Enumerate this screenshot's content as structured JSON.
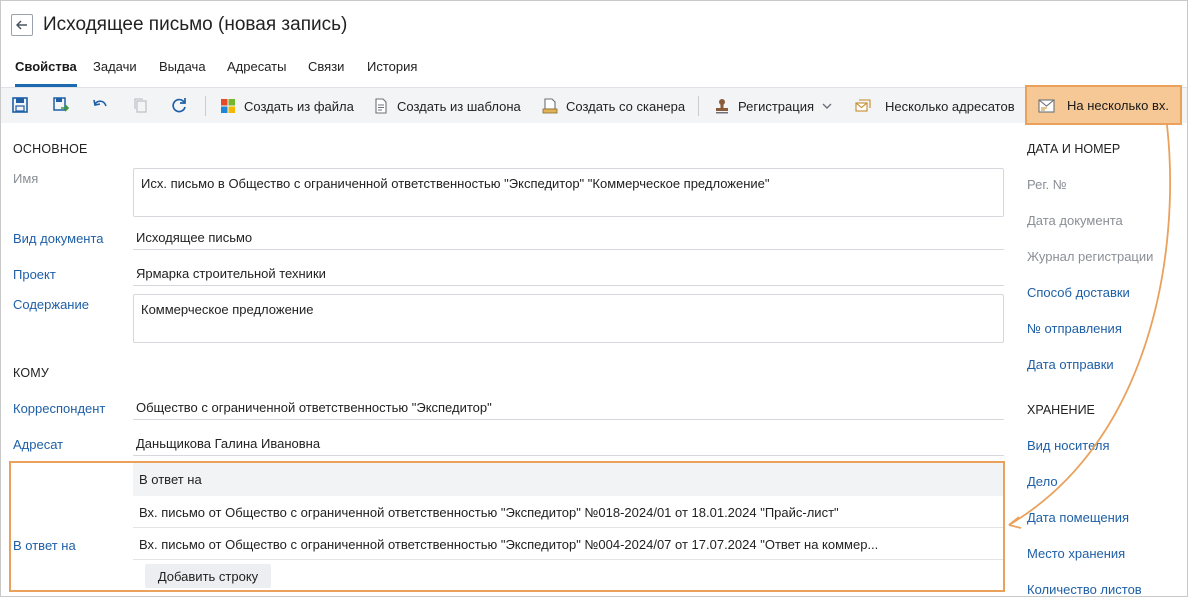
{
  "header": {
    "title": "Исходящее письмо (новая запись)",
    "tabs": [
      {
        "label": "Свойства",
        "active": true
      },
      {
        "label": "Задачи"
      },
      {
        "label": "Выдача"
      },
      {
        "label": "Адресаты"
      },
      {
        "label": "Связи"
      },
      {
        "label": "История"
      }
    ]
  },
  "toolbar": {
    "icons": [
      "save-icon",
      "save-and-close-icon",
      "undo-icon",
      "copy-icon",
      "refresh-icon"
    ],
    "create_from_file": "Создать из файла",
    "create_from_template": "Создать из шаблона",
    "create_from_scanner": "Создать со сканера",
    "registration": "Регистрация",
    "several_addressees": "Несколько адресатов",
    "several_incoming": "На несколько вх."
  },
  "main": {
    "section_basic": "ОСНОВНОЕ",
    "name_label": "Имя",
    "name_value": "Исх. письмо в Общество с ограниченной ответственностью \"Экспедитор\" \"Коммерческое предложение\"",
    "doc_type_label": "Вид документа",
    "doc_type_value": "Исходящее письмо",
    "project_label": "Проект",
    "project_value": "Ярмарка строительной техники",
    "content_label": "Содержание",
    "content_value": "Коммерческое предложение",
    "section_to": "КОМУ",
    "correspondent_label": "Корреспондент",
    "correspondent_value": "Общество с ограниченной ответственностью \"Экспедитор\"",
    "addressee_label": "Адресат",
    "addressee_value": "Даньщикова Галина Ивановна",
    "in_reply_label": "В ответ на",
    "in_reply_header": "В ответ на",
    "in_reply_rows": [
      "Вх. письмо от Общество с ограниченной ответственностью \"Экспедитор\" №018-2024/01 от 18.01.2024 \"Прайс-лист\"",
      "Вх. письмо от Общество с ограниченной ответственностью \"Экспедитор\" №004-2024/07 от 17.07.2024 \"Ответ на коммер..."
    ],
    "add_row": "Добавить строку"
  },
  "right_panel": {
    "section_date": "ДАТА И НОМЕР",
    "reg_no": "Рег. №",
    "doc_date": "Дата документа",
    "reg_journal": "Журнал регистрации",
    "delivery_method": "Способ доставки",
    "dispatch_no": "№ отправления",
    "dispatch_date": "Дата отправки",
    "section_storage": "ХРАНЕНИЕ",
    "media_type": "Вид носителя",
    "case": "Дело",
    "placement_date": "Дата помещения",
    "storage_place": "Место хранения",
    "sheet_count": "Количество листов"
  },
  "colors": {
    "accent": "#1e6ab0",
    "link": "#1e5fa6",
    "highlight": "#eaa15c",
    "highlight_fill": "#f6c896"
  }
}
